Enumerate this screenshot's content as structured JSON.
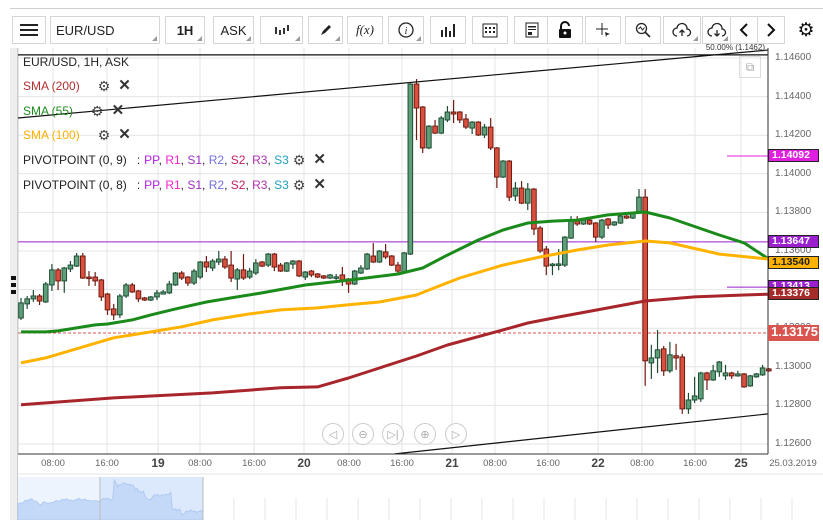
{
  "toolbar": {
    "symbol": "EUR/USD",
    "interval": "1H",
    "price_type": "ASK",
    "fx_label": "f(x)",
    "icons": [
      "menu-icon",
      "candlestick-type-icon",
      "pen-icon",
      "function-icon",
      "info-icon",
      "bar-chart-icon",
      "calendar-icon",
      "report-icon",
      "lock-icon",
      "crosshair-icon",
      "zoom-chart-icon",
      "cloud-upload-icon",
      "cloud-download-icon",
      "chevron-left-icon",
      "chevron-right-icon",
      "gear-icon"
    ]
  },
  "legend": {
    "title": "EUR/USD, 1H, ASK",
    "indicators": [
      {
        "label": "SMA (200)",
        "color": "#b03030"
      },
      {
        "label": "SMA (55)",
        "color": "#1e8a1e"
      },
      {
        "label": "SMA (100)",
        "color": "#ffb000"
      }
    ],
    "pivots": [
      {
        "label": "PIVOTPOINT (0, 9)"
      },
      {
        "label": "PIVOTPOINT (0, 8)"
      }
    ],
    "pivot_levels": [
      {
        "name": "PP",
        "color": "#b020e0"
      },
      {
        "name": "R1",
        "color": "#ff20d0"
      },
      {
        "name": "S1",
        "color": "#a030c0"
      },
      {
        "name": "R2",
        "color": "#7070e0"
      },
      {
        "name": "S2",
        "color": "#c02060"
      },
      {
        "name": "R3",
        "color": "#b030b0"
      },
      {
        "name": "S3",
        "color": "#20a0c0"
      }
    ],
    "sep": ":",
    "comma": ","
  },
  "fib_label": "50.00% (1.1462)",
  "chart_data": {
    "type": "candlestick",
    "title": "EUR/USD, 1H, ASK",
    "ylim": [
      1.125,
      1.1466
    ],
    "y_ticks": [
      "1.14600",
      "1.14400",
      "1.14200",
      "1.14000",
      "1.13800",
      "1.13600",
      "1.13400",
      "1.13200",
      "1.13000",
      "1.12800",
      "1.12600"
    ],
    "x_ticks": [
      {
        "label": "08:00",
        "day": false
      },
      {
        "label": "16:00",
        "day": false
      },
      {
        "label": "19",
        "day": true
      },
      {
        "label": "08:00",
        "day": false
      },
      {
        "label": "16:00",
        "day": false
      },
      {
        "label": "20",
        "day": true
      },
      {
        "label": "08:00",
        "day": false
      },
      {
        "label": "16:00",
        "day": false
      },
      {
        "label": "21",
        "day": true
      },
      {
        "label": "08:00",
        "day": false
      },
      {
        "label": "16:00",
        "day": false
      },
      {
        "label": "22",
        "day": true
      },
      {
        "label": "08:00",
        "day": false
      },
      {
        "label": "16:00",
        "day": false
      },
      {
        "label": "25",
        "day": true
      }
    ],
    "date_label": "25.03.2019",
    "price_labels": [
      {
        "value": "1.14092",
        "price": 1.14092,
        "color": "#e020e0",
        "line": "short"
      },
      {
        "value": "1.13647",
        "price": 1.13647,
        "color": "#9b1fcf",
        "line": "full"
      },
      {
        "value": "1.13540",
        "price": 1.1354,
        "color": "#ffb300",
        "line": "none",
        "text_color": "#222"
      },
      {
        "value": "1.13413",
        "price": 1.13413,
        "color": "#9b1fcf",
        "line": "short"
      },
      {
        "value": "1.13376",
        "price": 1.13376,
        "color": "#a52a2a",
        "line": "none"
      },
      {
        "value": "1.13175",
        "price": 1.13175,
        "color": "#d9534f",
        "line": "dashed"
      }
    ],
    "candles": [
      [
        1.13253,
        1.13357,
        1.13243,
        1.13331
      ],
      [
        1.13326,
        1.13367,
        1.133,
        1.13352
      ],
      [
        1.13352,
        1.13398,
        1.13336,
        1.13367
      ],
      [
        1.13367,
        1.13377,
        1.1332,
        1.13341
      ],
      [
        1.13336,
        1.13439,
        1.13331,
        1.13429
      ],
      [
        1.13424,
        1.13532,
        1.13393,
        1.13502
      ],
      [
        1.13502,
        1.13512,
        1.13398,
        1.13445
      ],
      [
        1.13445,
        1.13517,
        1.13383,
        1.13512
      ],
      [
        1.13507,
        1.13548,
        1.13491,
        1.13527
      ],
      [
        1.13522,
        1.1359,
        1.13517,
        1.13574
      ],
      [
        1.13574,
        1.1359,
        1.13455,
        1.1346
      ],
      [
        1.13465,
        1.13496,
        1.13419,
        1.1346
      ],
      [
        1.13465,
        1.13491,
        1.13419,
        1.13445
      ],
      [
        1.1345,
        1.13455,
        1.13341,
        1.13362
      ],
      [
        1.13377,
        1.13383,
        1.13269,
        1.13295
      ],
      [
        1.133,
        1.13326,
        1.13243,
        1.13269
      ],
      [
        1.13269,
        1.13377,
        1.13253,
        1.13367
      ],
      [
        1.13367,
        1.13434,
        1.13357,
        1.13424
      ],
      [
        1.13424,
        1.13434,
        1.13383,
        1.13388
      ],
      [
        1.13393,
        1.13398,
        1.13336,
        1.13352
      ],
      [
        1.13357,
        1.13362,
        1.13341,
        1.13346
      ],
      [
        1.13346,
        1.13367,
        1.13341,
        1.13362
      ],
      [
        1.13362,
        1.13398,
        1.13346,
        1.13383
      ],
      [
        1.13377,
        1.13398,
        1.13383,
        1.13388
      ],
      [
        1.13383,
        1.13445,
        1.13377,
        1.13429
      ],
      [
        1.13424,
        1.13491,
        1.13419,
        1.13486
      ],
      [
        1.13486,
        1.13496,
        1.1345,
        1.1346
      ],
      [
        1.13465,
        1.1347,
        1.13419,
        1.13434
      ],
      [
        1.13434,
        1.13507,
        1.13424,
        1.13496
      ],
      [
        1.13465,
        1.13548,
        1.13455,
        1.13543
      ],
      [
        1.13543,
        1.13574,
        1.13491,
        1.13517
      ],
      [
        1.13512,
        1.13558,
        1.13496,
        1.13548
      ],
      [
        1.13543,
        1.136,
        1.13527,
        1.13558
      ],
      [
        1.13558,
        1.13574,
        1.13507,
        1.13517
      ],
      [
        1.13527,
        1.136,
        1.13439,
        1.1346
      ],
      [
        1.13455,
        1.13512,
        1.13398,
        1.13502
      ],
      [
        1.13502,
        1.13584,
        1.1345,
        1.1346
      ],
      [
        1.13465,
        1.13512,
        1.13455,
        1.13496
      ],
      [
        1.13486,
        1.13558,
        1.13476,
        1.13538
      ],
      [
        1.13543,
        1.13548,
        1.13517,
        1.13522
      ],
      [
        1.13527,
        1.1359,
        1.13517,
        1.13584
      ],
      [
        1.13584,
        1.1359,
        1.13496,
        1.13517
      ],
      [
        1.13527,
        1.13538,
        1.13491,
        1.13496
      ],
      [
        1.13496,
        1.13543,
        1.13491,
        1.13538
      ],
      [
        1.13532,
        1.13553,
        1.13507,
        1.13548
      ],
      [
        1.13548,
        1.13553,
        1.13465,
        1.13471
      ],
      [
        1.13465,
        1.13496,
        1.1345,
        1.13491
      ],
      [
        1.13496,
        1.13502,
        1.13465,
        1.13476
      ],
      [
        1.13481,
        1.13486,
        1.1346,
        1.13465
      ],
      [
        1.13471,
        1.13476,
        1.13455,
        1.1346
      ],
      [
        1.1346,
        1.13481,
        1.13455,
        1.13476
      ],
      [
        1.13465,
        1.13481,
        1.1345,
        1.13466
      ],
      [
        1.13476,
        1.13517,
        1.13419,
        1.1345
      ],
      [
        1.13455,
        1.1346,
        1.13383,
        1.13429
      ],
      [
        1.13429,
        1.13502,
        1.13424,
        1.13496
      ],
      [
        1.13486,
        1.13527,
        1.13481,
        1.13512
      ],
      [
        1.13507,
        1.1359,
        1.13502,
        1.13584
      ],
      [
        1.13574,
        1.13641,
        1.13538,
        1.13543
      ],
      [
        1.13543,
        1.13605,
        1.13538,
        1.136
      ],
      [
        1.13595,
        1.13636,
        1.13558,
        1.13569
      ],
      [
        1.13574,
        1.13579,
        1.13522,
        1.13527
      ],
      [
        1.13527,
        1.13543,
        1.13486,
        1.13496
      ],
      [
        1.13491,
        1.13595,
        1.13486,
        1.1359
      ],
      [
        1.13584,
        1.1447,
        1.13579,
        1.14465
      ],
      [
        1.14465,
        1.14491,
        1.14175,
        1.14341
      ],
      [
        1.14346,
        1.14351,
        1.14108,
        1.14134
      ],
      [
        1.14134,
        1.14252,
        1.14128,
        1.14247
      ],
      [
        1.14247,
        1.14279,
        1.14206,
        1.14211
      ],
      [
        1.14211,
        1.14299,
        1.14206,
        1.14289
      ],
      [
        1.14279,
        1.14351,
        1.14268,
        1.1432
      ],
      [
        1.1432,
        1.14382,
        1.14263,
        1.1431
      ],
      [
        1.1432,
        1.14325,
        1.14263,
        1.14279
      ],
      [
        1.14284,
        1.1431,
        1.14232,
        1.14242
      ],
      [
        1.14237,
        1.14273,
        1.14206,
        1.14268
      ],
      [
        1.14268,
        1.14273,
        1.14196,
        1.14201
      ],
      [
        1.14201,
        1.14258,
        1.14185,
        1.14242
      ],
      [
        1.14242,
        1.14289,
        1.14123,
        1.14134
      ],
      [
        1.14134,
        1.14139,
        1.13926,
        1.13983
      ],
      [
        1.13983,
        1.14071,
        1.13978,
        1.14066
      ],
      [
        1.14066,
        1.14071,
        1.13859,
        1.13879
      ],
      [
        1.13885,
        1.13957,
        1.13859,
        1.13926
      ],
      [
        1.13926,
        1.13962,
        1.13843,
        1.13848
      ],
      [
        1.13848,
        1.13952,
        1.13812,
        1.13921
      ],
      [
        1.13921,
        1.13926,
        1.13683,
        1.13714
      ],
      [
        1.13719,
        1.1373,
        1.1359,
        1.136
      ],
      [
        1.1361,
        1.13626,
        1.13475,
        1.13522
      ],
      [
        1.13527,
        1.13538,
        1.13475,
        1.13532
      ],
      [
        1.13527,
        1.1361,
        1.135,
        1.13533
      ],
      [
        1.13527,
        1.13677,
        1.13517,
        1.13672
      ],
      [
        1.13667,
        1.13781,
        1.13662,
        1.13755
      ],
      [
        1.13755,
        1.13781,
        1.1373,
        1.1374
      ],
      [
        1.1374,
        1.13771,
        1.13735,
        1.1376
      ],
      [
        1.1376,
        1.13766,
        1.13735,
        1.1374
      ],
      [
        1.13745,
        1.1375,
        1.13646,
        1.13672
      ],
      [
        1.13672,
        1.13766,
        1.13662,
        1.1376
      ],
      [
        1.13766,
        1.13771,
        1.13714,
        1.13735
      ],
      [
        1.13735,
        1.13755,
        1.1373,
        1.1375
      ],
      [
        1.13745,
        1.13786,
        1.1374,
        1.13781
      ],
      [
        1.13781,
        1.13786,
        1.13766,
        1.13771
      ],
      [
        1.13771,
        1.13802,
        1.13766,
        1.13797
      ],
      [
        1.13797,
        1.13921,
        1.13792,
        1.13879
      ],
      [
        1.13879,
        1.13921,
        1.12901,
        1.13031
      ],
      [
        1.1302,
        1.13114,
        1.12937,
        1.13046
      ],
      [
        1.13046,
        1.13191,
        1.12968,
        1.13088
      ],
      [
        1.13093,
        1.13108,
        1.12953,
        1.12979
      ],
      [
        1.12979,
        1.13129,
        1.12968,
        1.13062
      ],
      [
        1.13057,
        1.13119,
        1.12984,
        1.13046
      ],
      [
        1.13051,
        1.13067,
        1.12756,
        1.12782
      ],
      [
        1.12782,
        1.12865,
        1.12756,
        1.12828
      ],
      [
        1.12828,
        1.12948,
        1.12813,
        1.12849
      ],
      [
        1.12834,
        1.12974,
        1.12818,
        1.12968
      ],
      [
        1.12968,
        1.12974,
        1.1288,
        1.12932
      ],
      [
        1.12932,
        1.1301,
        1.12927,
        1.12979
      ],
      [
        1.12974,
        1.1303,
        1.12948,
        1.13025
      ],
      [
        1.12953,
        1.1301,
        1.12932,
        1.12968
      ],
      [
        1.12968,
        1.12974,
        1.12937,
        1.12953
      ],
      [
        1.12953,
        1.12979,
        1.12948,
        1.12963
      ],
      [
        1.12963,
        1.12968,
        1.12891,
        1.12896
      ],
      [
        1.12901,
        1.12958,
        1.12896,
        1.12953
      ],
      [
        1.12948,
        1.12968,
        1.12943,
        1.12963
      ],
      [
        1.12958,
        1.1301,
        1.12953,
        1.12994
      ],
      [
        1.12989,
        1.12994,
        1.12974,
        1.12979
      ]
    ],
    "series": [
      {
        "name": "SMA (55)",
        "color": "#1a8a1a",
        "points": [
          [
            0,
            1.13181
          ],
          [
            4,
            1.13181
          ],
          [
            6,
            1.13186
          ],
          [
            12,
            1.13217
          ],
          [
            14,
            1.13222
          ],
          [
            18,
            1.13243
          ],
          [
            21,
            1.13269
          ],
          [
            25,
            1.133
          ],
          [
            30,
            1.13336
          ],
          [
            34,
            1.13357
          ],
          [
            39,
            1.13383
          ],
          [
            46,
            1.13424
          ],
          [
            52,
            1.13445
          ],
          [
            61,
            1.13481
          ],
          [
            65,
            1.13512
          ],
          [
            69,
            1.13579
          ],
          [
            74,
            1.13657
          ],
          [
            78,
            1.13709
          ],
          [
            82,
            1.13745
          ],
          [
            86,
            1.13755
          ],
          [
            90,
            1.1376
          ],
          [
            95,
            1.13787
          ],
          [
            101,
            1.13802
          ],
          [
            105,
            1.13771
          ],
          [
            113,
            1.13683
          ],
          [
            117,
            1.13642
          ],
          [
            121,
            1.13558
          ]
        ]
      },
      {
        "name": "SMA (100)",
        "color": "#ffb300",
        "points": [
          [
            0,
            1.1302
          ],
          [
            4,
            1.13046
          ],
          [
            10,
            1.13103
          ],
          [
            15,
            1.1315
          ],
          [
            21,
            1.13181
          ],
          [
            26,
            1.13207
          ],
          [
            31,
            1.13243
          ],
          [
            37,
            1.13274
          ],
          [
            42,
            1.13295
          ],
          [
            48,
            1.13305
          ],
          [
            53,
            1.13321
          ],
          [
            58,
            1.13336
          ],
          [
            64,
            1.13372
          ],
          [
            66,
            1.13398
          ],
          [
            71,
            1.1346
          ],
          [
            78,
            1.13527
          ],
          [
            84,
            1.13569
          ],
          [
            90,
            1.13605
          ],
          [
            95,
            1.13631
          ],
          [
            101,
            1.13652
          ],
          [
            105,
            1.13642
          ],
          [
            113,
            1.13584
          ],
          [
            121,
            1.13558
          ]
        ]
      },
      {
        "name": "SMA (200)",
        "color": "#a8262b",
        "points": [
          [
            0,
            1.12803
          ],
          [
            15,
            1.12839
          ],
          [
            31,
            1.12865
          ],
          [
            42,
            1.12891
          ],
          [
            48,
            1.12896
          ],
          [
            53,
            1.12942
          ],
          [
            58,
            1.12994
          ],
          [
            64,
            1.13056
          ],
          [
            69,
            1.13113
          ],
          [
            78,
            1.13191
          ],
          [
            82,
            1.13227
          ],
          [
            87,
            1.13258
          ],
          [
            95,
            1.13305
          ],
          [
            101,
            1.13341
          ],
          [
            109,
            1.13362
          ],
          [
            117,
            1.13372
          ],
          [
            121,
            1.13376
          ]
        ]
      }
    ],
    "trendlines": [
      {
        "from": [
          -0.5,
          1.14289
        ],
        "to": [
          121.4,
          1.14641
        ]
      },
      {
        "from": [
          60.5,
          1.12549
        ],
        "to": [
          121.4,
          1.12756
        ]
      },
      {
        "from": [
          -0.5,
          1.14616
        ],
        "to": [
          121.4,
          1.14616
        ]
      }
    ],
    "colors": {
      "up_fill": "#5e9e78",
      "up_border": "#1d4d33",
      "down_fill": "#d9503f",
      "down_border": "#6e1a10"
    }
  },
  "nav_buttons": [
    "scroll-left",
    "zoom-out",
    "go-to-end",
    "zoom-in",
    "scroll-right"
  ]
}
